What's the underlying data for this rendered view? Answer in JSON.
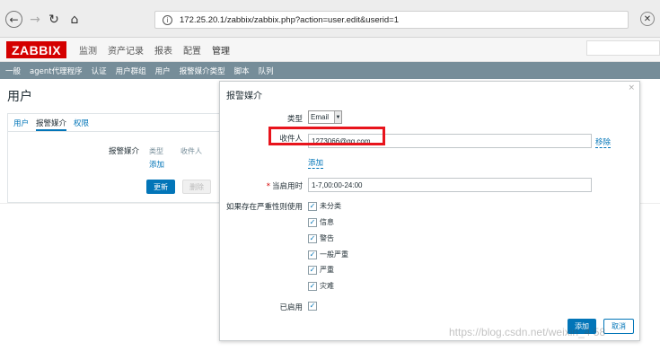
{
  "browser": {
    "url": "172.25.20.1/zabbix/zabbix.php?action=user.edit&userid=1"
  },
  "header": {
    "logo": "ZABBIX",
    "menu": [
      "监测",
      "资产记录",
      "报表",
      "配置",
      "管理"
    ]
  },
  "subnav": {
    "items": [
      "一般",
      "agent代理程序",
      "认证",
      "用户群组",
      "用户",
      "报警媒介类型",
      "脚本",
      "队列"
    ]
  },
  "page": {
    "title": "用户",
    "tabs": [
      "用户",
      "报警媒介",
      "权限"
    ],
    "media_label": "报警媒介",
    "media_columns": [
      "类型",
      "收件人"
    ],
    "add_link": "添加",
    "update_button": "更新",
    "delete_button": "删除"
  },
  "modal": {
    "title": "报警媒介",
    "close": "×",
    "type_label": "类型",
    "type_value": "Email",
    "recipient_label": "收件人",
    "recipient_value": "1273066@qq.com",
    "remove_link": "移除",
    "add_link": "添加",
    "when_active_label": "当启用时",
    "when_active_value": "1-7,00:00-24:00",
    "severity_label": "如果存在严重性则使用",
    "severities": [
      "未分类",
      "信息",
      "警告",
      "一般严重",
      "严重",
      "灾难"
    ],
    "enabled_label": "已启用",
    "add_button": "添加",
    "cancel_button": "取消"
  },
  "watermark": "https://blog.csdn.net/weixin_4 58"
}
